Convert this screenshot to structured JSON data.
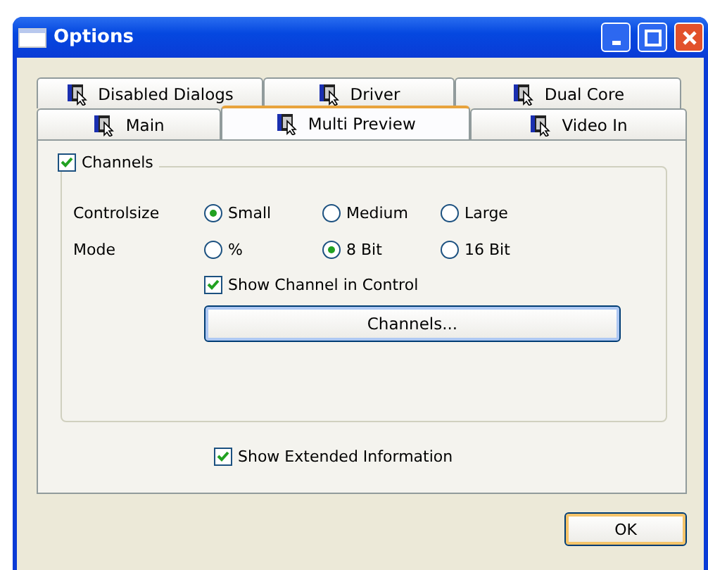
{
  "window": {
    "title": "Options"
  },
  "tab_rows": [
    [
      {
        "label": "Disabled Dialogs",
        "selected": false
      },
      {
        "label": "Driver",
        "selected": false
      },
      {
        "label": "Dual Core",
        "selected": false
      }
    ],
    [
      {
        "label": "Main",
        "selected": false
      },
      {
        "label": "Multi Preview",
        "selected": true
      },
      {
        "label": "Video In",
        "selected": false
      }
    ]
  ],
  "group": {
    "label": "Channels",
    "checked": true
  },
  "radio_rows": [
    {
      "label": "Controlsize",
      "options": [
        {
          "label": "Small",
          "selected": true
        },
        {
          "label": "Medium",
          "selected": false
        },
        {
          "label": "Large",
          "selected": false
        }
      ]
    },
    {
      "label": "Mode",
      "options": [
        {
          "label": "%",
          "selected": false
        },
        {
          "label": "8 Bit",
          "selected": true
        },
        {
          "label": "16 Bit",
          "selected": false
        }
      ]
    }
  ],
  "show_channel": {
    "label": "Show Channel in Control",
    "checked": true
  },
  "channels_button": "Channels...",
  "show_extended": {
    "label": "Show Extended Information",
    "checked": true
  },
  "ok_button": "OK"
}
